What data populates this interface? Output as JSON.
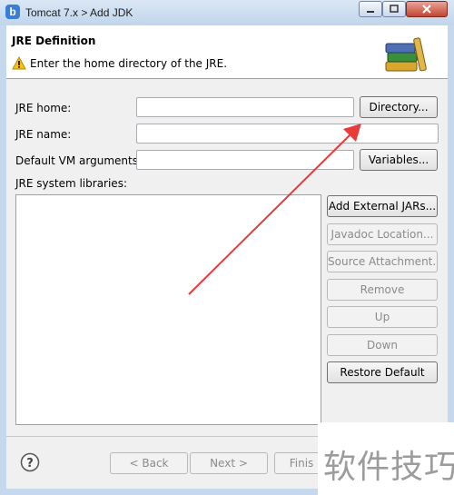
{
  "window": {
    "title": "Tomcat  7.x > Add JDK",
    "app_icon_letter": "b"
  },
  "header": {
    "title": "JRE Definition",
    "message": "Enter the home directory of the JRE."
  },
  "form": {
    "jre_home_label": "JRE home:",
    "jre_home_value": "",
    "jre_name_label": "JRE name:",
    "jre_name_value": "",
    "vm_args_label": "Default VM arguments:",
    "vm_args_value": "",
    "libraries_label": "JRE system libraries:"
  },
  "buttons": {
    "directory": "Directory...",
    "variables": "Variables...",
    "add_external_jars": "Add External JARs...",
    "javadoc_location": "Javadoc Location...",
    "source_attachment": "Source Attachment...",
    "remove": "Remove",
    "up": "Up",
    "down": "Down",
    "restore_default": "Restore Default",
    "back": "< Back",
    "next": "Next >",
    "finish": "Finis"
  },
  "watermark": "软件技巧",
  "colors": {
    "annotation_arrow": "#e83b3b",
    "close_button": "#c34530"
  }
}
